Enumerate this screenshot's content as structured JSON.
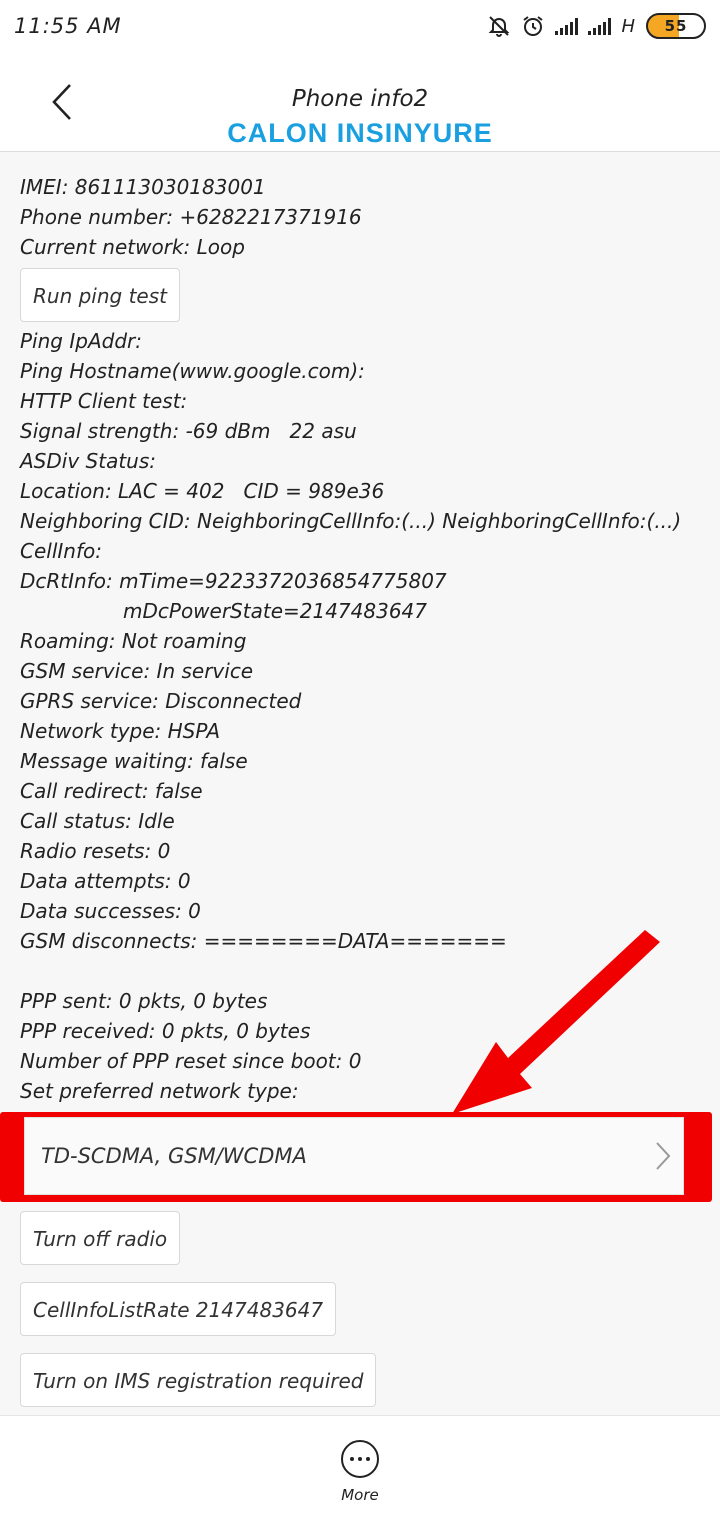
{
  "status_bar": {
    "time": "11:55 AM",
    "network_label": "H",
    "battery_level": "55",
    "icons": [
      "mute-icon",
      "alarm-icon",
      "signal-icon",
      "signal-icon",
      "battery-icon"
    ]
  },
  "header": {
    "title": "Phone info2",
    "watermark": "CALON INSINYURE"
  },
  "info": {
    "imei": "IMEI: 861113030183001",
    "phone_number": "Phone number: +6282217371916",
    "current_network": "Current network: Loop",
    "ping_button": "Run ping test",
    "ping_ip": "Ping IpAddr:",
    "ping_hostname": "Ping Hostname(www.google.com):",
    "http_test": "HTTP Client test:",
    "signal_strength": "Signal strength: -69 dBm   22 asu",
    "asdiv_status": "ASDiv Status:",
    "location": "Location: LAC = 402   CID = 989e36",
    "neighboring_cid": "Neighboring CID: NeighboringCellInfo:(...) NeighboringCellInfo:(...)",
    "cell_info": "CellInfo:",
    "dcrt_info_1": "DcRtInfo: mTime=9223372036854775807",
    "dcrt_info_2": "mDcPowerState=2147483647",
    "roaming": "Roaming: Not roaming",
    "gsm_service": "GSM service: In service",
    "gprs_service": "GPRS service: Disconnected",
    "network_type": "Network type: HSPA",
    "message_waiting": "Message waiting: false",
    "call_redirect": "Call redirect: false",
    "call_status": "Call status: Idle",
    "radio_resets": "Radio resets: 0",
    "data_attempts": "Data attempts: 0",
    "data_successes": "Data successes: 0",
    "gsm_disconnects": "GSM disconnects: ========DATA=======",
    "ppp_sent": "PPP sent: 0 pkts, 0 bytes",
    "ppp_received": "PPP received: 0 pkts, 0 bytes",
    "ppp_reset": "Number of PPP reset since boot: 0",
    "set_preferred": "Set preferred network type:"
  },
  "preferred_network": {
    "selected": "TD-SCDMA, GSM/WCDMA"
  },
  "buttons": {
    "turn_off_radio": "Turn off radio",
    "cell_info_rate": "CellInfoListRate 2147483647",
    "ims_registration": "Turn on IMS registration required"
  },
  "bottom_bar": {
    "more_label": "More"
  },
  "colors": {
    "watermark": "#1aa0e0",
    "highlight": "#f00000",
    "battery": "#f5a623"
  }
}
